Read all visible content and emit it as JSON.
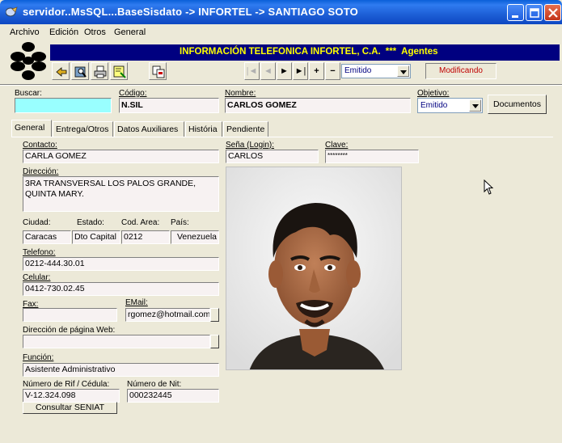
{
  "window": {
    "title": "servidor..MsSQL...BaseSisdato -> INFORTEL -> SANTIAGO SOTO"
  },
  "menu": [
    "Archivo",
    "Edición",
    "Otros",
    "General"
  ],
  "banner": {
    "company": "INFORMACIÓN TELEFONICA INFORTEL, C.A.",
    "stars": "***",
    "module": "Agentes"
  },
  "toolbar": {
    "status_combo": "Emitido",
    "mode": "Modificando",
    "nav": [
      "|◄",
      "◄",
      "►",
      "►|",
      "+",
      "−"
    ]
  },
  "header_fields": {
    "buscar": {
      "label": "Buscar:",
      "value": ""
    },
    "codigo": {
      "label": "Código:",
      "value": "N.SIL"
    },
    "nombre": {
      "label": "Nombre:",
      "value": "CARLOS GOMEZ"
    },
    "objetivo": {
      "label": "Objetivo:",
      "value": "Emitido"
    },
    "documentos_button": "Documentos"
  },
  "tabs": [
    "General",
    "Entrega/Otros",
    "Datos Auxiliares",
    "História",
    "Pendiente"
  ],
  "general": {
    "contacto": {
      "label": "Contacto:",
      "value": "CARLA GOMEZ"
    },
    "sena": {
      "label": "Seña (Login):",
      "value": "CARLOS"
    },
    "clave": {
      "label": "Clave:",
      "value": "********"
    },
    "direccion": {
      "label": "Dirección:",
      "line1": "3RA TRANSVERSAL LOS PALOS GRANDE,",
      "line2": "QUINTA MARY."
    },
    "ciudad": {
      "label": "Ciudad:",
      "value": "Caracas"
    },
    "estado": {
      "label": "Estado:",
      "value": "Dto Capital"
    },
    "cod_area": {
      "label": "Cod. Area:",
      "value": "0212"
    },
    "pais": {
      "label": "País:",
      "value": "Venezuela"
    },
    "telefono": {
      "label": "Telefono:",
      "value": "0212-444.30.01"
    },
    "celular": {
      "label": "Celular:",
      "value": "0412-730.02.45"
    },
    "fax": {
      "label": "Fax:",
      "value": ""
    },
    "email": {
      "label": "EMail:",
      "value": "rgomez@hotmail.com"
    },
    "web": {
      "label": "Dirección de página Web:",
      "value": ""
    },
    "funcion": {
      "label": "Función:",
      "value": "Asistente Administrativo"
    },
    "rif": {
      "label": "Número de Rif / Cédula:",
      "value": "V-12.324.098"
    },
    "nit": {
      "label": "Número de Nit:",
      "value": "000232445"
    },
    "seniat_button": "Consultar SENIAT"
  },
  "icons": [
    "app-icon",
    "logo-icon",
    "back-icon",
    "search-icon",
    "print-icon",
    "note-icon",
    "copy-icon",
    "minimize-icon",
    "maximize-icon",
    "close-icon",
    "mouse-cursor-icon"
  ],
  "colors": {
    "banner_bg": "#000080",
    "banner_text": "#ffff00",
    "mode_text": "#c00000",
    "search_bg": "#99ffff"
  }
}
